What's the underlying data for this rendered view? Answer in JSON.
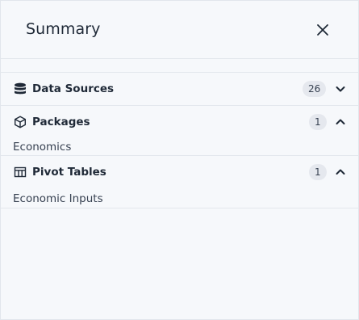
{
  "header": {
    "title": "Summary",
    "close_icon": "close-icon"
  },
  "sections": [
    {
      "label": "Data Sources",
      "count": "26",
      "icon": "database-icon",
      "expanded": false,
      "items": []
    },
    {
      "label": "Packages",
      "count": "1",
      "icon": "package-icon",
      "expanded": true,
      "items": [
        "Economics"
      ]
    },
    {
      "label": "Pivot Tables",
      "count": "1",
      "icon": "table-icon",
      "expanded": true,
      "items": [
        "Economic Inputs"
      ]
    }
  ],
  "colors": {
    "panel_background": "#f6f8fb",
    "badge_background": "#e5e8ee",
    "text": "#1f2937",
    "divider": "#e3e7ed"
  }
}
